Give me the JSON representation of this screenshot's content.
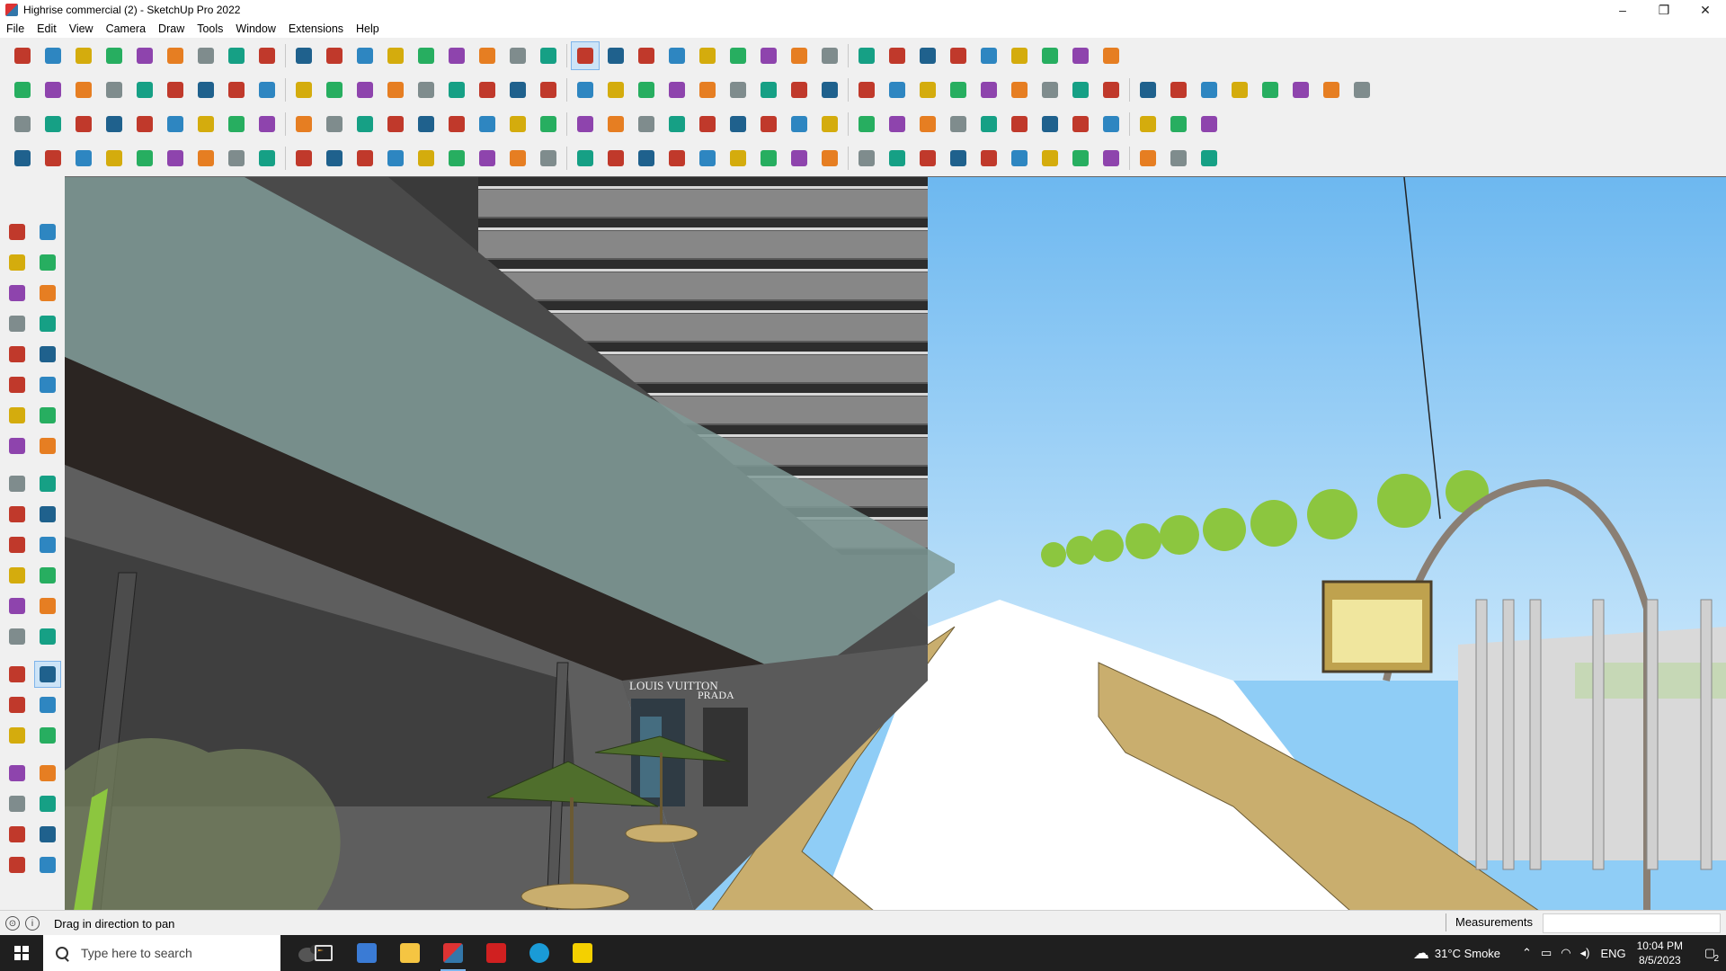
{
  "window": {
    "title": "Highrise commercial (2) - SketchUp Pro 2022",
    "minimize": "–",
    "restore": "❐",
    "close": "✕"
  },
  "menu": [
    "File",
    "Edit",
    "View",
    "Camera",
    "Draw",
    "Tools",
    "Window",
    "Extensions",
    "Help"
  ],
  "toolbar_rows": [
    {
      "count": 36,
      "icons": [
        "zoom-extents",
        "select",
        "eraser",
        "line",
        "arc",
        "rectangle",
        "push-pull",
        "follow-me",
        "move",
        "rotate",
        "scale",
        "tape",
        "text",
        "paint",
        "orbit",
        "pan",
        "zoom",
        "zoom-window",
        "section",
        "display",
        "layer",
        "styles",
        "camera",
        "components",
        "sandbox",
        "dimension",
        "undo",
        "redo",
        "warehouse"
      ]
    },
    {
      "count": 44,
      "icons": [
        "solid-union",
        "solid-intersect",
        "solid-trim",
        "push-pull-solid"
      ]
    },
    {
      "count": 39,
      "icons": [
        "plane",
        "plane-blue",
        "plane-yellow",
        "plane-red"
      ]
    },
    {
      "count": 39,
      "icons": [
        "draw-tools",
        "roof",
        "stair"
      ]
    }
  ],
  "left_tools": [
    "select-icon",
    "orbit-icon",
    "paint-icon",
    "eraser-icon",
    "component-icon",
    "tape-icon",
    "line-icon",
    "freehand-icon",
    "rectangle-icon",
    "rotated-rect-icon",
    "circle-icon",
    "polygon-icon",
    "arc-icon",
    "arc2-icon",
    "pie-icon",
    "arc3-icon",
    "move-icon",
    "push-pull-icon",
    "rotate-icon",
    "follow-me-icon",
    "scale-icon",
    "offset-icon",
    "tape2-icon",
    "text-icon",
    "protractor-icon",
    "3d-text-icon",
    "axes-icon",
    "dimension-icon",
    "orbit2-icon",
    "pan-icon",
    "zoom-icon",
    "zoom-window-icon",
    "zoom-extents-icon",
    "previous-icon",
    "walk-icon",
    "look-around-icon",
    "footprints-icon",
    "position-camera-icon",
    "section-icon",
    "section2-icon",
    "section3-icon",
    "section4-icon"
  ],
  "status": {
    "hint": "Drag in direction to pan",
    "measurements_label": "Measurements"
  },
  "taskbar": {
    "search_placeholder": "Type here to search",
    "weather": "31°C  Smoke",
    "language": "ENG",
    "time": "10:04 PM",
    "date": "8/5/2023",
    "notifications": "2"
  },
  "scene": {
    "sign_1": "LOUIS VUITTON",
    "sign_2": "PRADA"
  },
  "colors": {
    "sky": "#7cc3f2",
    "ground_paving": "#c9ae6e",
    "building_dark": "#3a3a3a",
    "canopy_glass": "#7f9a96",
    "umbrella": "#4f6e2c",
    "tree": "#8cc63f",
    "selected_tool": "#cde4f7"
  }
}
